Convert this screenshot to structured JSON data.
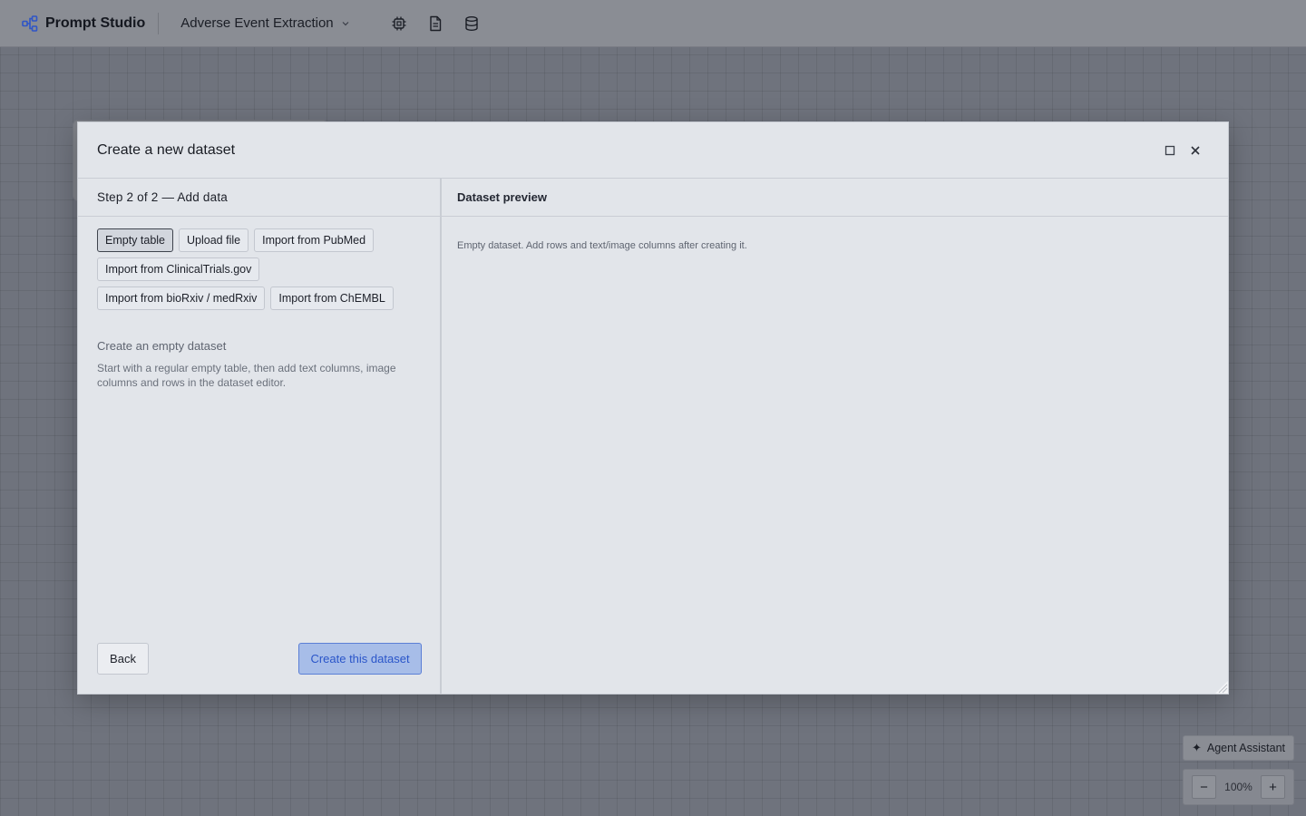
{
  "app": {
    "name": "Prompt Studio",
    "project": "Adverse Event Extraction",
    "toolbar_icons": [
      "chip-icon",
      "document-icon",
      "database-icon"
    ]
  },
  "modal": {
    "title": "Create a new dataset",
    "step_label": "Step 2 of 2 — Add data",
    "sources": [
      {
        "label": "Empty table",
        "selected": true
      },
      {
        "label": "Upload file",
        "selected": false
      },
      {
        "label": "Import from PubMed",
        "selected": false
      },
      {
        "label": "Import from ClinicalTrials.gov",
        "selected": false
      },
      {
        "label": "Import from bioRxiv / medRxiv",
        "selected": false
      },
      {
        "label": "Import from ChEMBL",
        "selected": false
      }
    ],
    "description": {
      "title": "Create an empty dataset",
      "text": "Start with a regular empty table, then add text columns, image columns and rows in the dataset editor."
    },
    "back_label": "Back",
    "create_label": "Create this dataset",
    "preview": {
      "title": "Dataset preview",
      "empty_message": "Empty dataset. Add rows and text/image columns after creating it."
    }
  },
  "agent": {
    "label": "Agent Assistant",
    "icon": "sparkle-icon"
  },
  "zoom": {
    "level": "100%",
    "minus": "−",
    "plus": "+"
  },
  "colors": {
    "accent": "#5b7fd6",
    "accent_fill": "#a7bde8",
    "brand_icon": "#2f55c7"
  }
}
